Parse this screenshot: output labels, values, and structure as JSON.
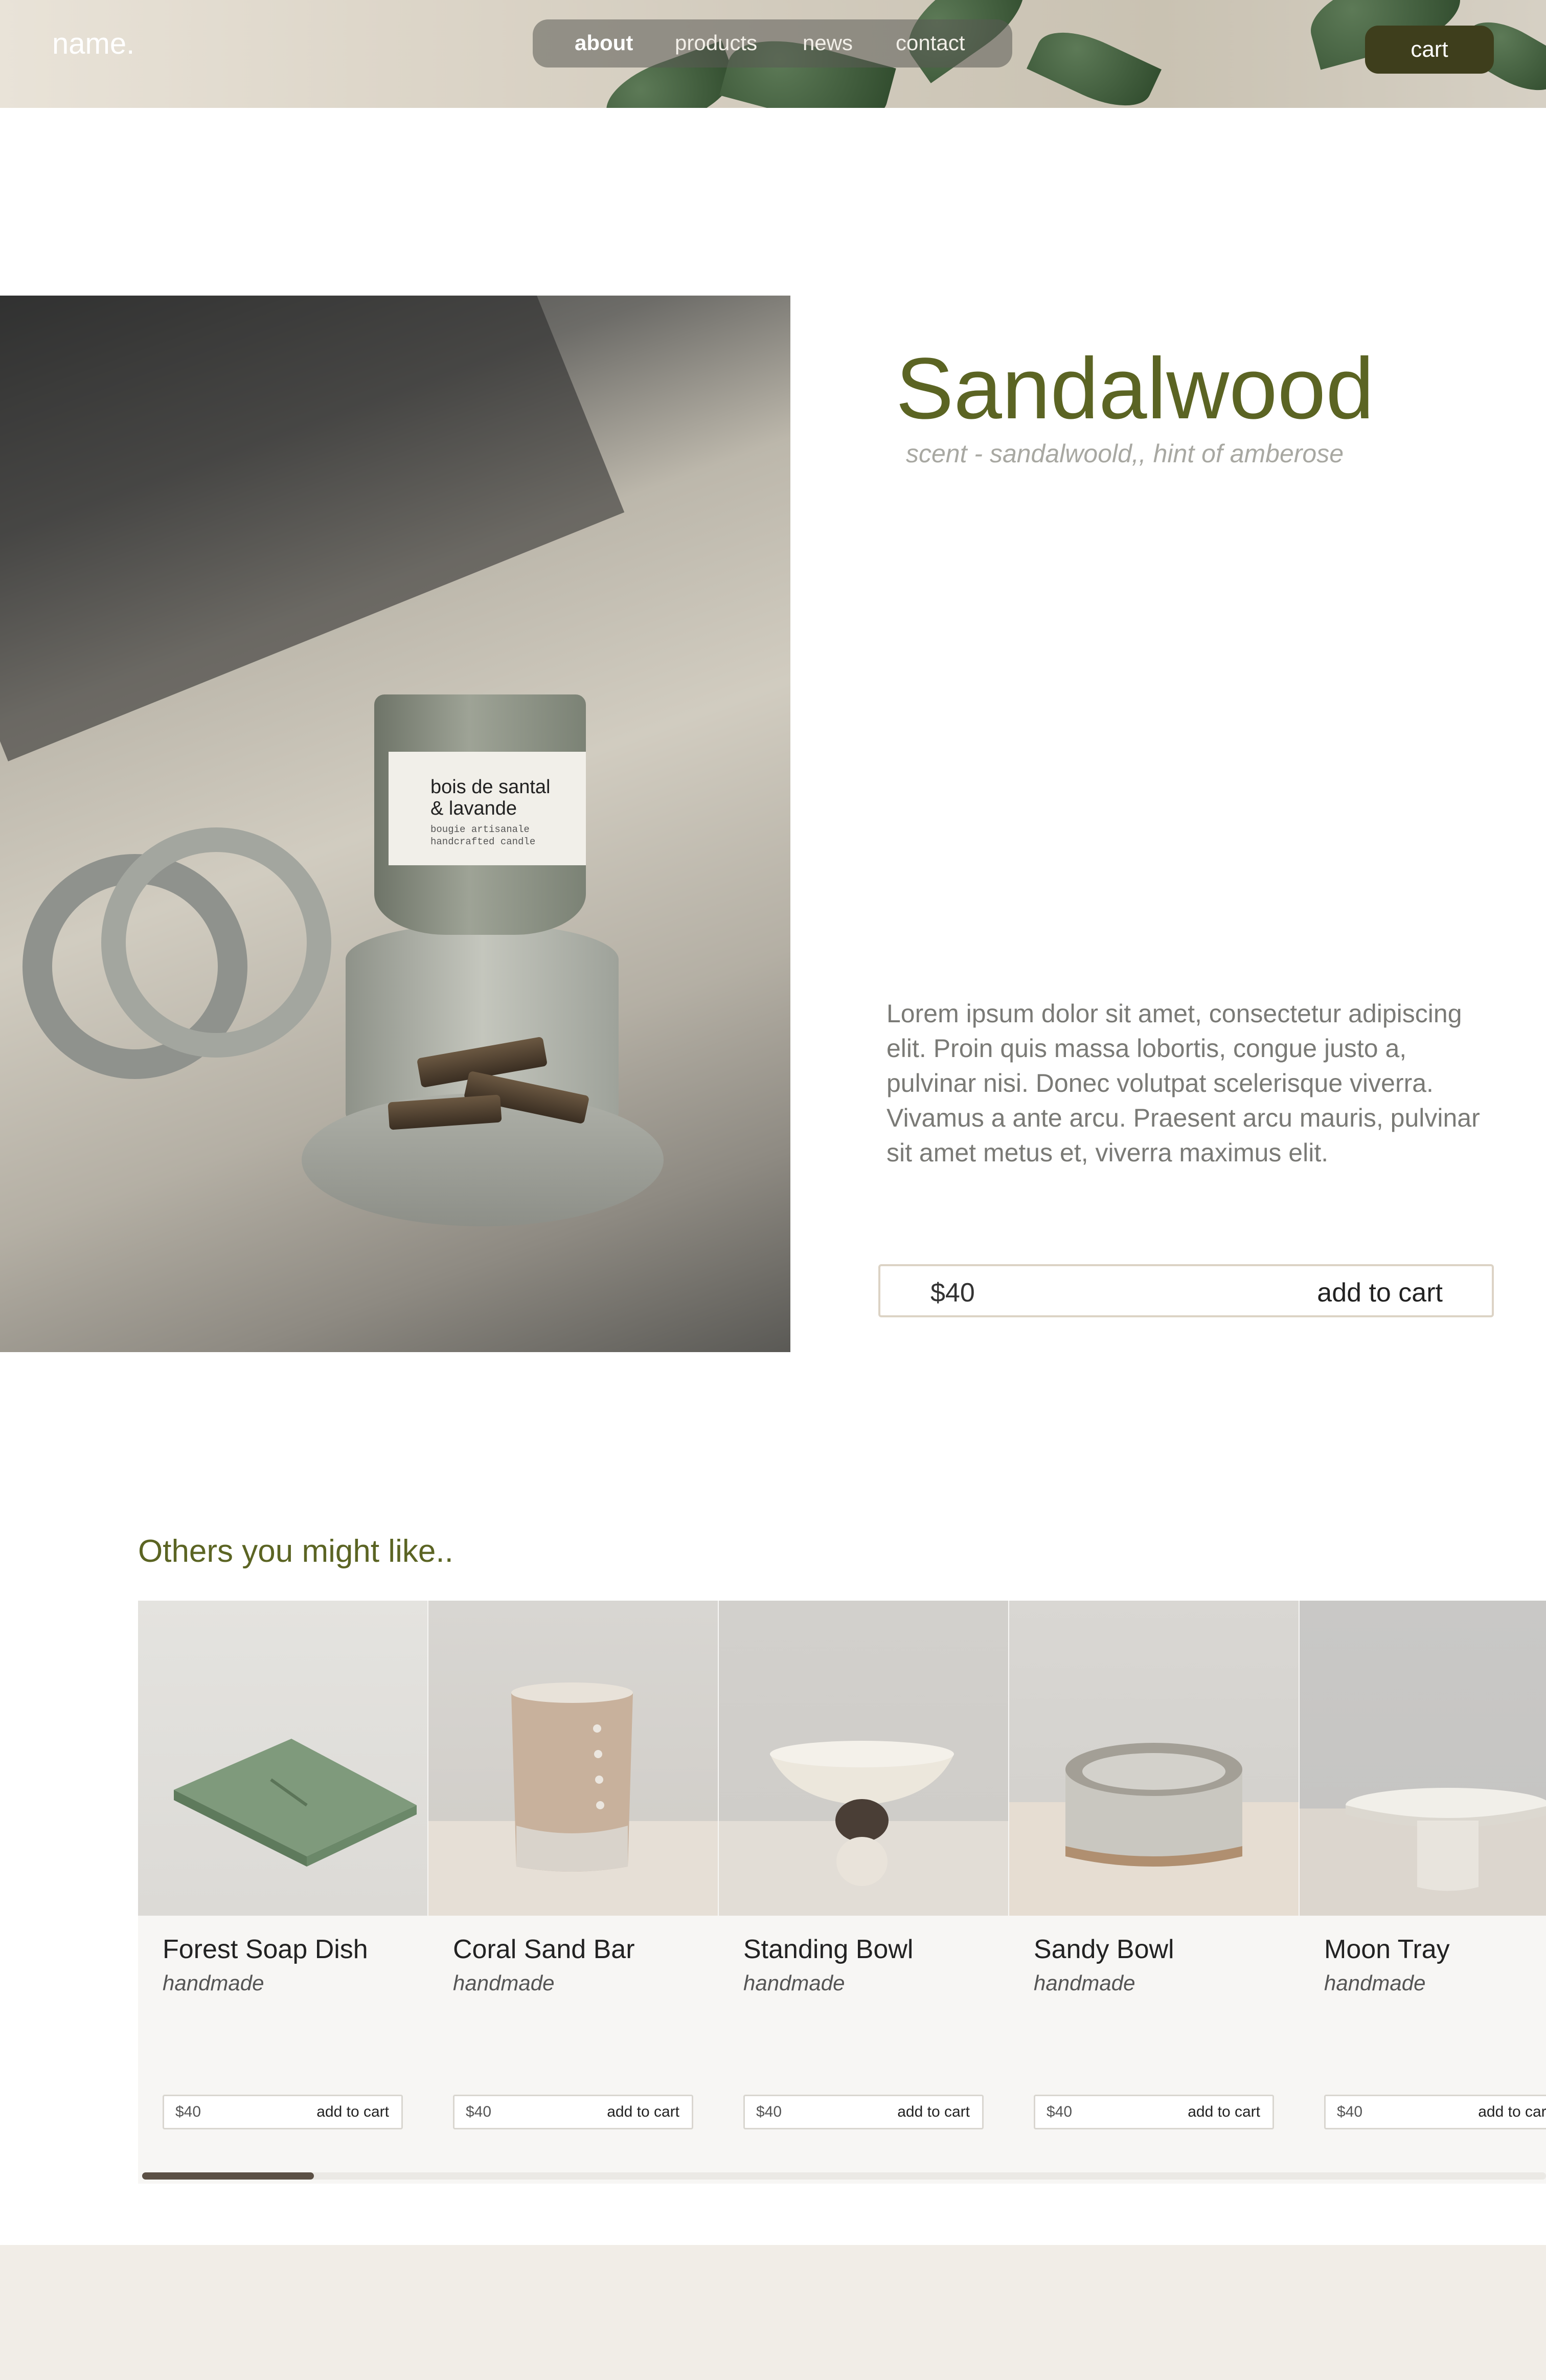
{
  "header": {
    "logo": "name.",
    "nav": [
      {
        "label": "about",
        "active": true
      },
      {
        "label": "products",
        "active": false
      },
      {
        "label": "news",
        "active": false
      },
      {
        "label": "contact",
        "active": false
      }
    ],
    "cart_label": "cart"
  },
  "product": {
    "title": "Sandalwood",
    "subtitle": "scent - sandalwoold,, hint of amberose",
    "description": "Lorem ipsum dolor sit amet, consectetur adipiscing elit. Proin quis massa lobortis, congue justo a, pulvinar nisi. Donec volutpat scelerisque viverra. Vivamus a ante arcu. Praesent arcu mauris, pulvinar sit amet metus et, viverra maximus elit.",
    "price": "$40",
    "add_to_cart": "add to cart",
    "label_line1": "bois de santal",
    "label_line2": "& lavande",
    "label_line3": "bougie artisanale",
    "label_line4": "handcrafted candle"
  },
  "related": {
    "heading": "Others you might like..",
    "items": [
      {
        "name": "Forest Soap Dish",
        "sub": "handmade",
        "price": "$40",
        "add": "add to cart"
      },
      {
        "name": "Coral Sand Bar",
        "sub": "handmade",
        "price": "$40",
        "add": "add to cart"
      },
      {
        "name": "Standing Bowl",
        "sub": "handmade",
        "price": "$40",
        "add": "add to cart"
      },
      {
        "name": "Sandy Bowl",
        "sub": "handmade",
        "price": "$40",
        "add": "add to cart"
      },
      {
        "name": "Moon Tray",
        "sub": "handmade",
        "price": "$40",
        "add": "add to cart"
      }
    ]
  },
  "colors": {
    "accent_olive": "#5b6423",
    "cart_button": "#3e3e1c",
    "scroll_thumb": "#5b5045",
    "footer_bg": "#f1ede7"
  }
}
